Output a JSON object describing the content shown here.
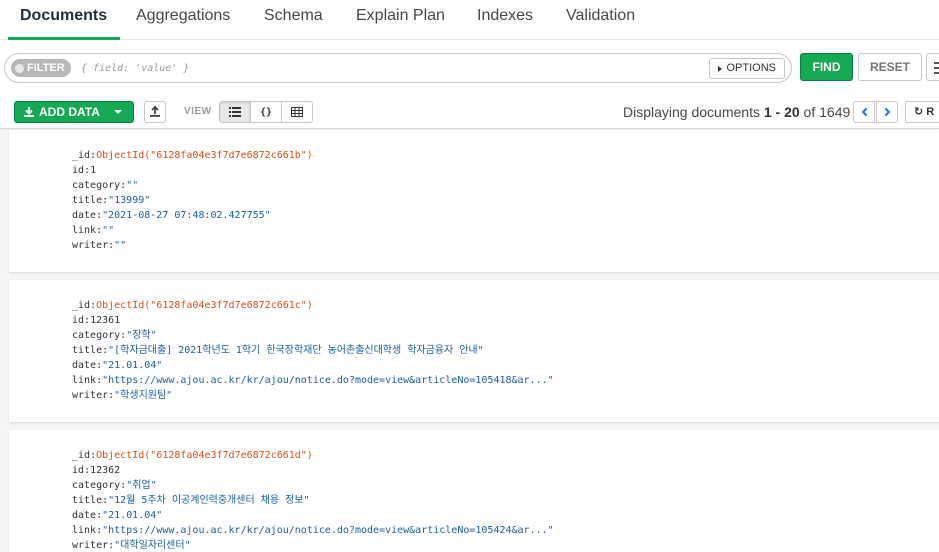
{
  "tabs": [
    {
      "label": "Documents",
      "active": true
    },
    {
      "label": "Aggregations"
    },
    {
      "label": "Schema"
    },
    {
      "label": "Explain Plan"
    },
    {
      "label": "Indexes"
    },
    {
      "label": "Validation"
    }
  ],
  "filter": {
    "pill_label": "FILTER",
    "placeholder": "{ field: 'value' }",
    "options_label": "OPTIONS",
    "find_label": "FIND",
    "reset_label": "RESET"
  },
  "toolbar": {
    "add_data_label": "ADD DATA",
    "view_label": "VIEW",
    "display_prefix": "Displaying documents ",
    "range": "1 - 20",
    "of_text": " of ",
    "total": "1649",
    "refresh_label": "R"
  },
  "colors": {
    "accent_green": "#13aa52",
    "string_value": "#1c5fa8",
    "objectid_value": "#e04e16",
    "nav_blue": "#1b6ef3"
  },
  "documents": [
    {
      "fields": [
        {
          "key": "_id:",
          "value": "ObjectId(\"6128fa04e3f7d7e6872c661b\")",
          "kind": "oid"
        },
        {
          "key": "id:",
          "value": "1",
          "kind": "num"
        },
        {
          "key": "category:",
          "value": "\"\"",
          "kind": "str"
        },
        {
          "key": "title:",
          "value": "\"13999\"",
          "kind": "str"
        },
        {
          "key": "date:",
          "value": "\"2021-08-27 07:48:02.427755\"",
          "kind": "str"
        },
        {
          "key": "link:",
          "value": "\"\"",
          "kind": "str"
        },
        {
          "key": "writer:",
          "value": "\"\"",
          "kind": "str"
        }
      ]
    },
    {
      "fields": [
        {
          "key": "_id:",
          "value": "ObjectId(\"6128fa04e3f7d7e6872c661c\")",
          "kind": "oid"
        },
        {
          "key": "id:",
          "value": "12361",
          "kind": "num"
        },
        {
          "key": "category:",
          "value": "\"장학\"",
          "kind": "str"
        },
        {
          "key": "title:",
          "value": "\"[학자금대출] 2021학년도 1학기 한국장학재단 농어촌출신대학생 학자금융자 안내\"",
          "kind": "str"
        },
        {
          "key": "date:",
          "value": "\"21.01.04\"",
          "kind": "str"
        },
        {
          "key": "link:",
          "value": "\"https://www.ajou.ac.kr/kr/ajou/notice.do?mode=view&articleNo=105418&ar...\"",
          "kind": "str"
        },
        {
          "key": "writer:",
          "value": "\"학생지원팀\"",
          "kind": "str"
        }
      ]
    },
    {
      "fields": [
        {
          "key": "_id:",
          "value": "ObjectId(\"6128fa04e3f7d7e6872c661d\")",
          "kind": "oid"
        },
        {
          "key": "id:",
          "value": "12362",
          "kind": "num"
        },
        {
          "key": "category:",
          "value": "\"취업\"",
          "kind": "str"
        },
        {
          "key": "title:",
          "value": "\"12월 5주차 이공계인력중개센터 채용 정보\"",
          "kind": "str"
        },
        {
          "key": "date:",
          "value": "\"21.01.04\"",
          "kind": "str"
        },
        {
          "key": "link:",
          "value": "\"https://www.ajou.ac.kr/kr/ajou/notice.do?mode=view&articleNo=105424&ar...\"",
          "kind": "str"
        },
        {
          "key": "writer:",
          "value": "\"대학일자리센터\"",
          "kind": "str"
        }
      ]
    }
  ]
}
